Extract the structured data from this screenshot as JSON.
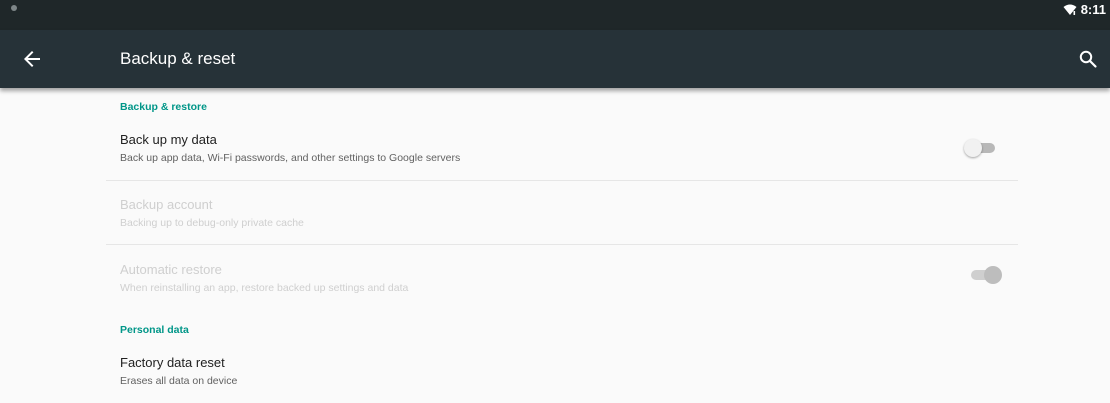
{
  "status_bar": {
    "time": "8:11",
    "icons": [
      "notification-dot-icon",
      "wifi-icon"
    ]
  },
  "app_bar": {
    "title": "Backup & reset",
    "back_icon": "arrow-back-icon",
    "search_icon": "search-icon"
  },
  "sections": [
    {
      "header": "Backup & restore",
      "items": [
        {
          "title": "Back up my data",
          "summary": "Back up app data, Wi-Fi passwords, and other settings to Google servers",
          "enabled": true,
          "switch": "off"
        },
        {
          "title": "Backup account",
          "summary": "Backing up to debug-only private cache",
          "enabled": false
        },
        {
          "title": "Automatic restore",
          "summary": "When reinstalling an app, restore backed up settings and data",
          "enabled": false,
          "switch": "on"
        }
      ]
    },
    {
      "header": "Personal data",
      "items": [
        {
          "title": "Factory data reset",
          "summary": "Erases all data on device",
          "enabled": true
        }
      ]
    }
  ],
  "colors": {
    "status_bar": "#1f2729",
    "app_bar": "#263238",
    "accent": "#009688",
    "background": "#fafafa"
  }
}
